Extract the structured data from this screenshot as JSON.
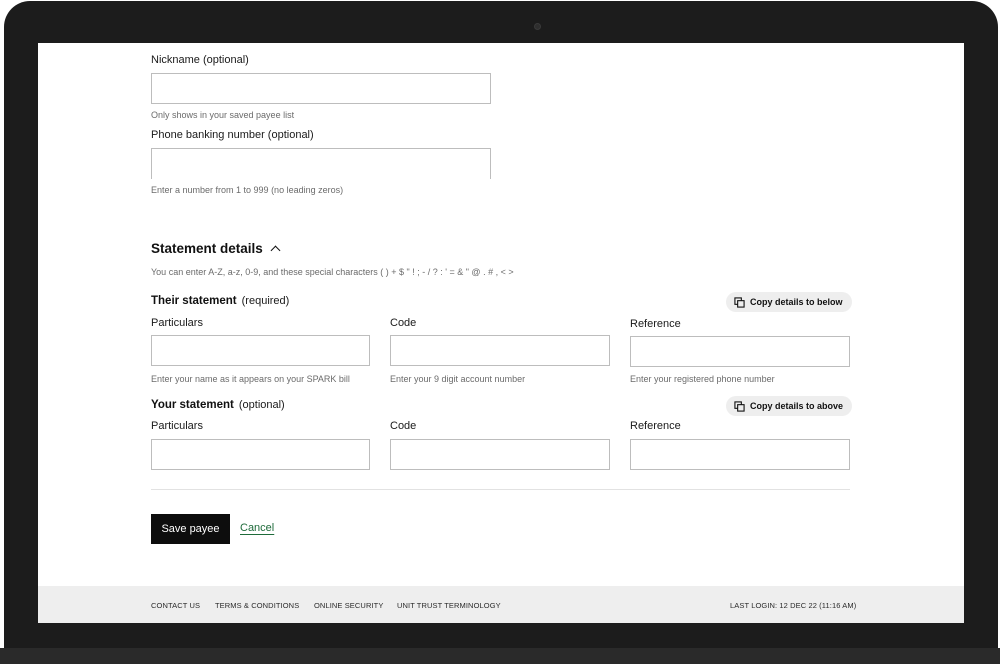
{
  "form": {
    "nickname": {
      "label": "Nickname (optional)",
      "value": "",
      "hint": "Only shows in your saved payee list"
    },
    "phone_banking": {
      "label": "Phone banking number (optional)",
      "value": "",
      "hint": "Enter a number from 1 to 999 (no leading zeros)"
    }
  },
  "statement": {
    "title": "Statement details",
    "note": "You can enter A-Z, a-z, 0-9, and these special characters ( ) + $ \" ! ; - / ? : ' = & \" @ . # , < >",
    "their": {
      "title": "Their statement",
      "qualifier": "(required)",
      "copy_label": "Copy details to below",
      "fields": [
        {
          "label": "Particulars",
          "value": "",
          "hint": "Enter your name as it appears on your SPARK bill"
        },
        {
          "label": "Code",
          "value": "",
          "hint": "Enter your 9 digit account number"
        },
        {
          "label": "Reference",
          "value": "",
          "hint": "Enter your registered phone number"
        }
      ]
    },
    "yours": {
      "title": "Your statement",
      "qualifier": "(optional)",
      "copy_label": "Copy details to above",
      "fields": [
        {
          "label": "Particulars",
          "value": ""
        },
        {
          "label": "Code",
          "value": ""
        },
        {
          "label": "Reference",
          "value": ""
        }
      ]
    }
  },
  "actions": {
    "save_label": "Save payee",
    "cancel_label": "Cancel"
  },
  "footer": {
    "links": [
      "CONTACT US",
      "TERMS & CONDITIONS",
      "ONLINE SECURITY",
      "UNIT TRUST TERMINOLOGY"
    ],
    "last_login": "LAST LOGIN: 12 DEC 22 (11:16 AM)"
  },
  "colors": {
    "accent_link": "#1e6b3a",
    "primary_button": "#0d0d0d",
    "footer_bg": "#eeeeee"
  },
  "icons": {
    "collapse": "chevron-up-icon",
    "copy": "copy-icon"
  }
}
